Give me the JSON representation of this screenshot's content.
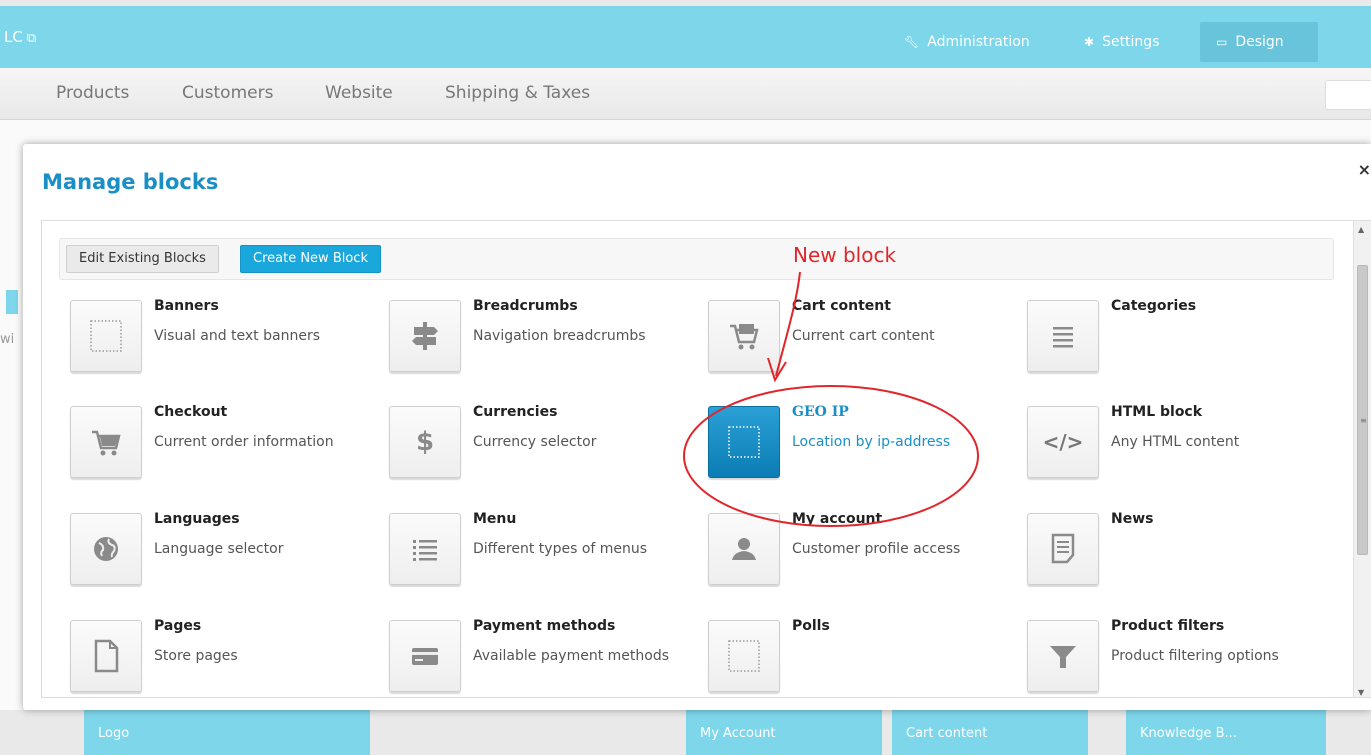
{
  "topbar": {
    "brand": "LC",
    "brand_icon": "external-link-icon",
    "nav": [
      {
        "label": "Administration",
        "icon": "wrench-icon"
      },
      {
        "label": "Settings",
        "icon": "gear-icon"
      },
      {
        "label": "Design",
        "icon": "monitor-icon",
        "active": true
      }
    ],
    "colors": {
      "bar": "#7dd6ea",
      "active": "#68c4da"
    }
  },
  "subnav": {
    "items": [
      "Products",
      "Customers",
      "Website",
      "Shipping & Taxes"
    ]
  },
  "background": {
    "partial_text": "wi",
    "blocks": [
      "Logo",
      "My Account",
      "Cart content",
      "Knowledge B..."
    ]
  },
  "modal": {
    "title": "Manage blocks",
    "close": "×",
    "tabs": [
      {
        "label": "Edit Existing Blocks",
        "active": false
      },
      {
        "label": "Create New Block",
        "active": true
      }
    ],
    "accent": "#1a8fc5",
    "blocks": [
      {
        "name": "Banners",
        "desc": "Visual and text banners",
        "icon": "dotted-square-icon"
      },
      {
        "name": "Breadcrumbs",
        "desc": "Navigation breadcrumbs",
        "icon": "signpost-icon"
      },
      {
        "name": "Cart content",
        "desc": "Current cart content",
        "icon": "cart-full-icon"
      },
      {
        "name": "Categories",
        "desc": "",
        "icon": "list-icon"
      },
      {
        "name": "Checkout",
        "desc": "Current order information",
        "icon": "cart-icon"
      },
      {
        "name": "Currencies",
        "desc": "Currency selector",
        "icon": "dollar-icon"
      },
      {
        "name": "GEO IP",
        "desc": "Location by ip-address",
        "icon": "dotted-square-icon",
        "selected": true
      },
      {
        "name": "HTML block",
        "desc": "Any HTML content",
        "icon": "code-icon"
      },
      {
        "name": "Languages",
        "desc": "Language selector",
        "icon": "globe-icon"
      },
      {
        "name": "Menu",
        "desc": "Different types of menus",
        "icon": "bullet-list-icon"
      },
      {
        "name": "My account",
        "desc": "Customer profile access",
        "icon": "user-icon"
      },
      {
        "name": "News",
        "desc": "",
        "icon": "document-icon"
      },
      {
        "name": "Pages",
        "desc": "Store pages",
        "icon": "page-icon"
      },
      {
        "name": "Payment methods",
        "desc": "Available payment methods",
        "icon": "credit-card-icon"
      },
      {
        "name": "Polls",
        "desc": "",
        "icon": "dotted-square-icon"
      },
      {
        "name": "Product filters",
        "desc": "Product filtering options",
        "icon": "filter-icon"
      }
    ]
  },
  "annotation": {
    "label": "New block",
    "color": "#e1262b"
  }
}
